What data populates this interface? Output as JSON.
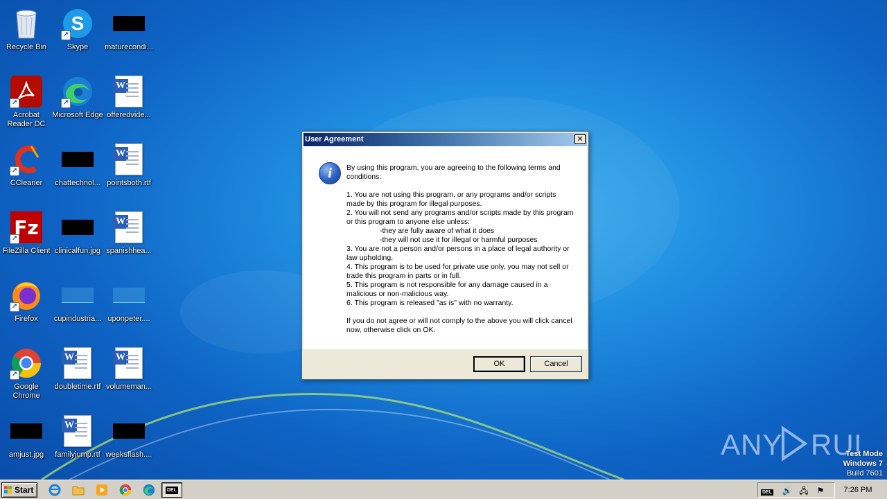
{
  "desktop": {
    "icons": [
      {
        "label": "Recycle Bin",
        "kind": "recycle-bin"
      },
      {
        "label": "Skype",
        "kind": "skype"
      },
      {
        "label": "maturecondi...",
        "kind": "black-thumb"
      },
      {
        "label": "Acrobat Reader DC",
        "kind": "acrobat"
      },
      {
        "label": "Microsoft Edge",
        "kind": "edge"
      },
      {
        "label": "offeredvide...",
        "kind": "word-doc"
      },
      {
        "label": "CCleaner",
        "kind": "ccleaner"
      },
      {
        "label": "chattechnol...",
        "kind": "black-thumb"
      },
      {
        "label": "pointsboth.rtf",
        "kind": "word-doc"
      },
      {
        "label": "FileZilla Client",
        "kind": "filezilla"
      },
      {
        "label": "clinicalfun.jpg",
        "kind": "black-thumb"
      },
      {
        "label": "spanishhea...",
        "kind": "word-doc"
      },
      {
        "label": "Firefox",
        "kind": "firefox"
      },
      {
        "label": "cupindustria...",
        "kind": "faded-thumb"
      },
      {
        "label": "uponpeter....",
        "kind": "faded-thumb"
      },
      {
        "label": "Google Chrome",
        "kind": "chrome"
      },
      {
        "label": "doubletime.rtf",
        "kind": "word-doc"
      },
      {
        "label": "volumeman...",
        "kind": "word-doc"
      },
      {
        "label": "amjust.jpg",
        "kind": "black-thumb"
      },
      {
        "label": "familyjump.rtf",
        "kind": "word-doc"
      },
      {
        "label": "weeksflash....",
        "kind": "black-thumb"
      }
    ]
  },
  "dialog": {
    "title": "User Agreement",
    "close_glyph": "✕",
    "icon": "information-icon",
    "intro": "By using this program, you are agreeing to the following terms and conditions:",
    "terms": [
      "1. You are not using this program, or any programs and/or scripts made by this program for illegal purposes.",
      "2. You will not send any programs and/or scripts made by this program or this program to anyone else unless:",
      "-they are fully aware of what it does",
      "-they will not use it for illegal or harmful purposes",
      "3. You are not a person and/or persons in a place of legal authority or law upholding.",
      "4. This program is to be used for private use only, you may not sell or trade this program in parts or in full.",
      "5. This program is not responsible for any damage caused in a malicious or non-malicious way.",
      "6. This program is released \"as is\" with no warranty."
    ],
    "closing": "If you do not agree or will not comply to the above you will click cancel now, otherwise click on OK.",
    "ok_label": "OK",
    "cancel_label": "Cancel"
  },
  "watermark": {
    "brand": "ANY RUN",
    "mode_line1": "Test Mode",
    "mode_line2": "Windows 7",
    "mode_line3": "Build 7601"
  },
  "taskbar": {
    "start_label": "Start",
    "active_app_badge": "DEL",
    "tray_badge": "DEL",
    "clock": "7:26 PM"
  }
}
